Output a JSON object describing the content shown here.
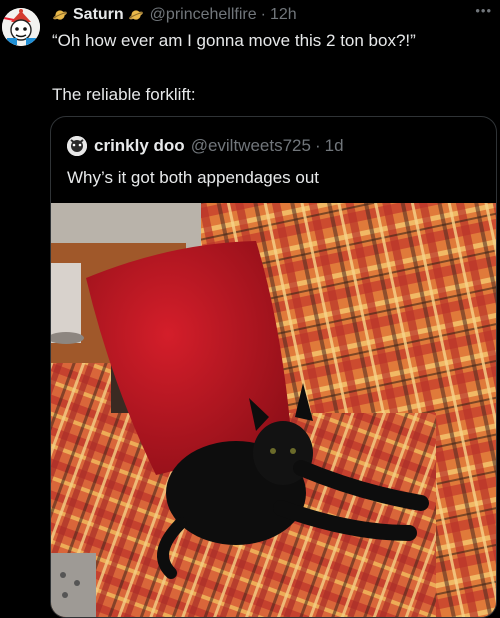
{
  "tweet": {
    "display_name": "Saturn",
    "handle": "@princehellfire",
    "separator": "·",
    "time": "12h",
    "more_label": "•••",
    "text_line1": "“Oh how ever am I gonna move this 2 ton box?!”",
    "text_line2": "The reliable forklift:"
  },
  "quoted": {
    "display_name": "crinkly doo",
    "handle": "@eviltweets725",
    "separator": "·",
    "time": "1d",
    "text": "Why’s it got both appendages out"
  },
  "icons": {
    "author_badge": "saturn-emoji-icon",
    "more": "ellipsis-icon"
  },
  "colors": {
    "background": "#000000",
    "primary_text": "#e7e9ea",
    "secondary_text": "#71767b",
    "border": "#2f3336"
  }
}
